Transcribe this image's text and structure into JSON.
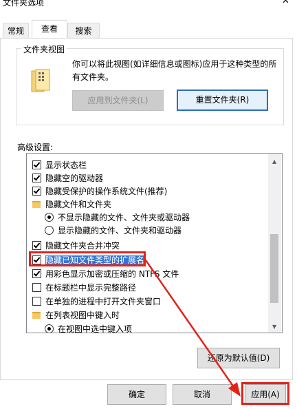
{
  "window": {
    "title": "文件夹选项",
    "close_glyph": "✕"
  },
  "tabs": [
    {
      "label": "常规"
    },
    {
      "label": "查看"
    },
    {
      "label": "搜索"
    }
  ],
  "folder_views": {
    "group_label": "文件夹视图",
    "description": "你可以将此视图(如详细信息或图标)应用于这种类型的所有文件夹。",
    "apply_button": "应用到文件夹(L)",
    "reset_button": "重置文件夹(R)"
  },
  "advanced": {
    "label": "高级设置:",
    "items": [
      {
        "type": "checkbox",
        "checked": true,
        "label": "显示状态栏"
      },
      {
        "type": "checkbox",
        "checked": true,
        "label": "隐藏空的驱动器"
      },
      {
        "type": "checkbox",
        "checked": true,
        "label": "隐藏受保护的操作系统文件(推荐)"
      },
      {
        "type": "folder",
        "label": "隐藏文件和文件夹"
      },
      {
        "type": "radio",
        "checked": true,
        "label": "不显示隐藏的文件、文件夹或驱动器"
      },
      {
        "type": "radio",
        "checked": false,
        "label": "显示隐藏的文件、文件夹和驱动器"
      },
      {
        "type": "checkbox",
        "checked": true,
        "label": "隐藏文件夹合并冲突"
      },
      {
        "type": "checkbox",
        "checked": true,
        "label": "隐藏已知文件类型的扩展名",
        "highlighted": true
      },
      {
        "type": "checkbox",
        "checked": true,
        "label": "用彩色显示加密或压缩的 NTFS 文件"
      },
      {
        "type": "checkbox",
        "checked": false,
        "label": "在标题栏中显示完整路径"
      },
      {
        "type": "checkbox",
        "checked": false,
        "label": "在单独的进程中打开文件夹窗口"
      },
      {
        "type": "folder",
        "label": "在列表视图中键入时"
      },
      {
        "type": "radio",
        "checked": true,
        "label": "在视图中选中键入项"
      }
    ],
    "restore_button": "还原为默认值(D)"
  },
  "footer": {
    "ok": "确定",
    "cancel": "取消",
    "apply": "应用(A)"
  },
  "colors": {
    "highlight": "#3375d6",
    "annotation_red": "#e2231a",
    "focus_blue": "#2a6ebc"
  }
}
